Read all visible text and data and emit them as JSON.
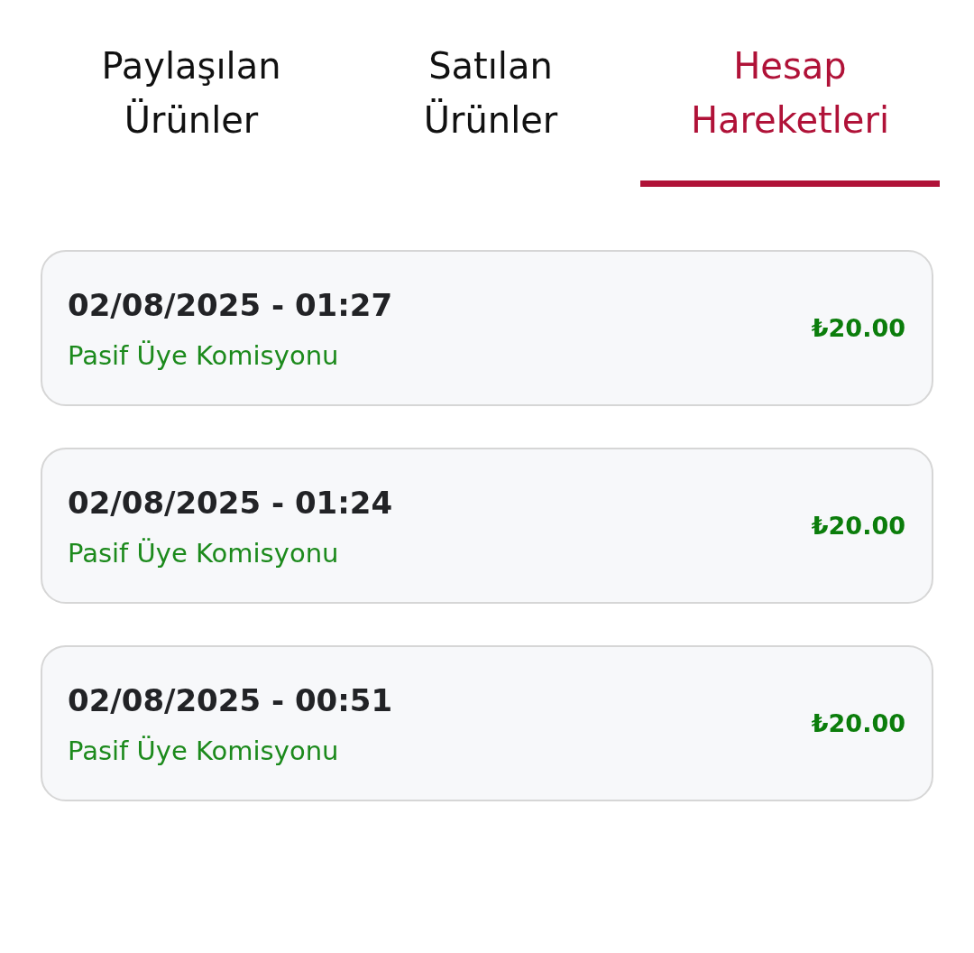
{
  "tabs": [
    {
      "label": "Paylaşılan Ürünler",
      "selected": false
    },
    {
      "label": "Satılan Ürünler",
      "selected": false
    },
    {
      "label": "Hesap Hareketleri",
      "selected": true
    }
  ],
  "transactions": [
    {
      "datetime": "02/08/2025 - 01:27",
      "description": "Pasif Üye Komisyonu",
      "amount": "₺20.00"
    },
    {
      "datetime": "02/08/2025 - 01:24",
      "description": "Pasif Üye Komisyonu",
      "amount": "₺20.00"
    },
    {
      "datetime": "02/08/2025 - 00:51",
      "description": "Pasif Üye Komisyonu",
      "amount": "₺20.00"
    }
  ]
}
